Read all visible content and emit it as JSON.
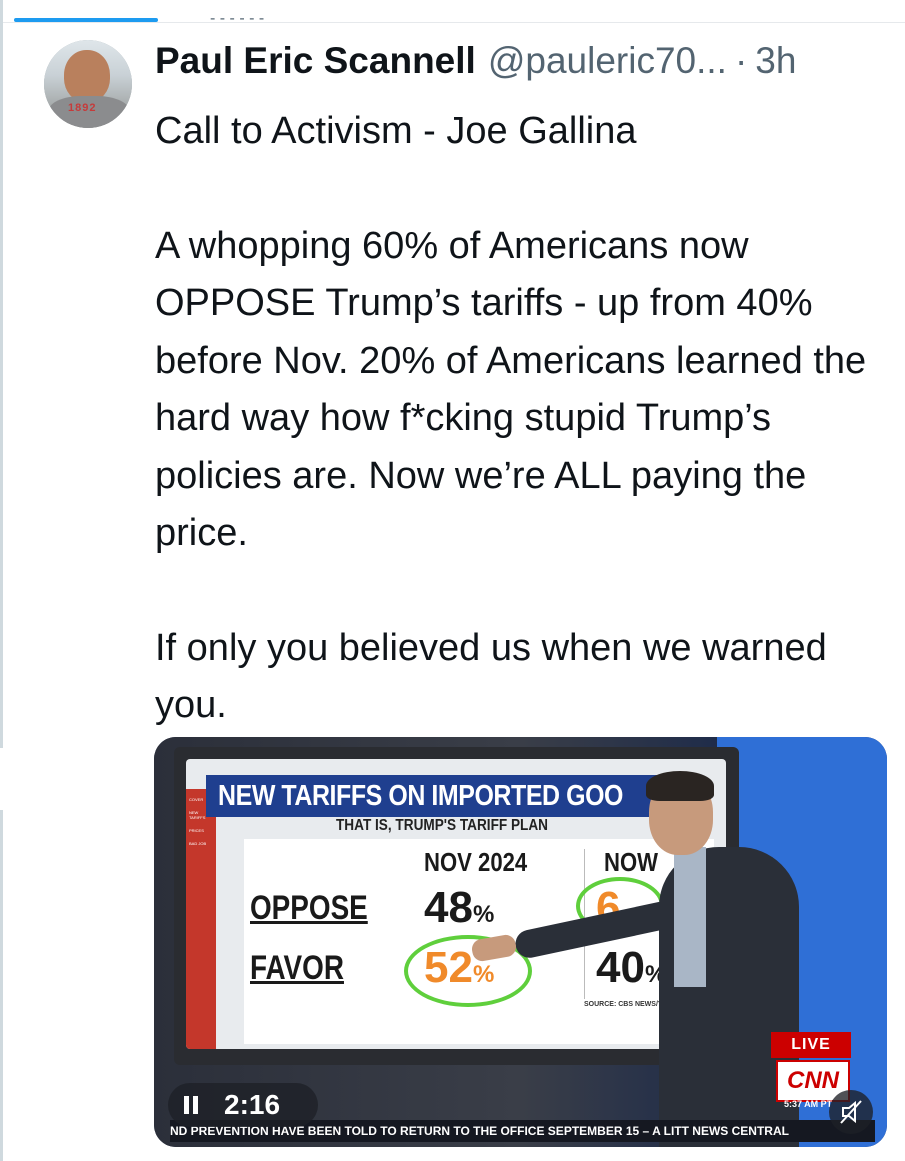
{
  "top_fragment": "- - - - - -",
  "post": {
    "author_name": "Paul Eric Scannell",
    "handle": "@pauleric70...",
    "separator": "·",
    "time": "3h",
    "paragraphs": [
      "Call to Activism - Joe Gallina",
      "A whopping 60% of Americans now OPPOSE Trump’s tariffs - up from 40% before Nov. 20% of Americans learned the hard way how f*cking stupid Trump’s policies are. Now we’re ALL paying the price.",
      "If only you believed us when we warned you."
    ],
    "avatar_shirt_text": "1892"
  },
  "video": {
    "headline": "NEW TARIFFS ON IMPORTED GOO",
    "subhead": "THAT IS, TRUMP'S TARIFF PLAN",
    "sidebar": [
      "COVER",
      "NEW TARIFFS",
      "PRICES",
      "BAD JOB"
    ],
    "columns": [
      "NOV 2024",
      "NOW"
    ],
    "rows": [
      {
        "label": "OPPOSE",
        "nov": "48",
        "now": "6"
      },
      {
        "label": "FAVOR",
        "nov": "52",
        "now": "40"
      }
    ],
    "percent_sign": "%",
    "source": "SOURCE: CBS NEWS/YOU",
    "live_label": "LIVE",
    "network": "CNN",
    "clock": "5:37 AM PT",
    "ticker": "ND PREVENTION HAVE BEEN TOLD TO RETURN TO THE OFFICE SEPTEMBER 15 – A LITT NEWS CENTRAL",
    "duration": "2:16"
  },
  "colors": {
    "text": "#0f1419",
    "muted": "#536471",
    "cnn_red": "#cc0000",
    "accent_blue": "#1d9bf0",
    "highlight_green": "#5fcf3c",
    "favor_orange": "#f08a2a"
  },
  "icons": [
    "pause-icon",
    "mute-icon"
  ]
}
